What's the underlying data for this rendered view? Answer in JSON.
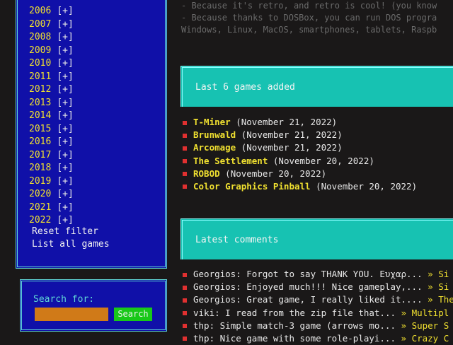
{
  "sidebar": {
    "years": [
      {
        "year": "2006",
        "tag": "[+]"
      },
      {
        "year": "2007",
        "tag": "[+]"
      },
      {
        "year": "2008",
        "tag": "[+]"
      },
      {
        "year": "2009",
        "tag": "[+]"
      },
      {
        "year": "2010",
        "tag": "[+]"
      },
      {
        "year": "2011",
        "tag": "[+]"
      },
      {
        "year": "2012",
        "tag": "[+]"
      },
      {
        "year": "2013",
        "tag": "[+]"
      },
      {
        "year": "2014",
        "tag": "[+]"
      },
      {
        "year": "2015",
        "tag": "[+]"
      },
      {
        "year": "2016",
        "tag": "[+]"
      },
      {
        "year": "2017",
        "tag": "[+]"
      },
      {
        "year": "2018",
        "tag": "[+]"
      },
      {
        "year": "2019",
        "tag": "[+]"
      },
      {
        "year": "2020",
        "tag": "[+]"
      },
      {
        "year": "2021",
        "tag": "[+]"
      },
      {
        "year": "2022",
        "tag": "[+]"
      }
    ],
    "reset_filter": "Reset filter",
    "list_all": "List all games"
  },
  "search": {
    "label": "Search for:",
    "value": "",
    "button": "Search"
  },
  "intro": {
    "line1": "- Because it's retro, and retro is cool! (you know",
    "line2": "- Because thanks to DOSBox, you can run DOS progra",
    "line3": "Windows, Linux, MacOS, smartphones, tablets, Raspb"
  },
  "games_section": {
    "title": "Last 6 games added",
    "items": [
      {
        "name": "T-Miner",
        "date": "(November 21, 2022)"
      },
      {
        "name": "Brunwald",
        "date": "(November 21, 2022)"
      },
      {
        "name": "Arcomage",
        "date": "(November 21, 2022)"
      },
      {
        "name": "The Settlement",
        "date": "(November 20, 2022)"
      },
      {
        "name": "ROBOD",
        "date": "(November 20, 2022)"
      },
      {
        "name": "Color Graphics Pinball",
        "date": "(November 20, 2022)"
      }
    ]
  },
  "comments_section": {
    "title": "Latest comments",
    "items": [
      {
        "author": "Georgios:",
        "text": "Forgot to say THANK YOU. Ευχαρ...",
        "link": "» Si"
      },
      {
        "author": "Georgios:",
        "text": "Enjoyed much!!! Nice gameplay,...",
        "link": "» Si"
      },
      {
        "author": "Georgios:",
        "text": "Great game, I really liked it....",
        "link": "» The"
      },
      {
        "author": "viki:",
        "text": "I read from the zip file that...",
        "link": "» Multipl"
      },
      {
        "author": "thp:",
        "text": "Simple match-3 game (arrows mo...",
        "link": "» Super S"
      },
      {
        "author": "thp:",
        "text": "Nice game with some role-playi...",
        "link": "» Crazy C"
      }
    ]
  }
}
